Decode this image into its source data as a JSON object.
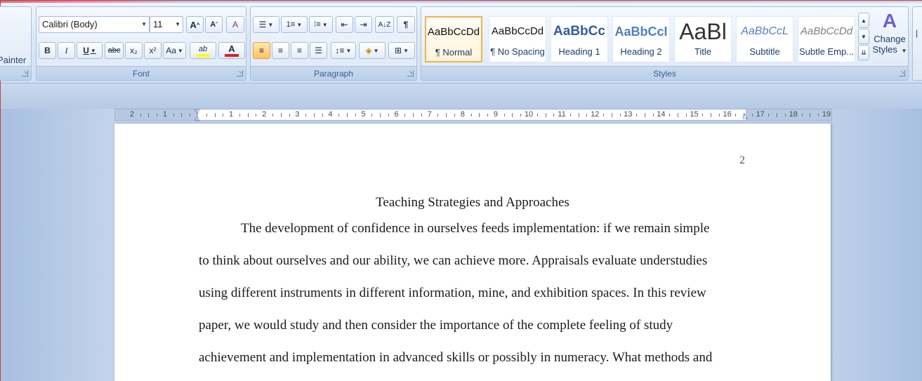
{
  "clipboard": {
    "label": "Painter"
  },
  "font": {
    "name": "Calibri (Body)",
    "size": "11",
    "grow_label": "A",
    "shrink_label": "A",
    "clear_label": "A",
    "bold": "B",
    "italic": "I",
    "underline": "U",
    "strike": "abc",
    "subscript": "x₂",
    "superscript": "x²",
    "change_case": "Aa",
    "highlight_label": "ab",
    "font_color_label": "A",
    "group_label": "Font",
    "highlight_color": "#ffff00",
    "font_color": "#e02020"
  },
  "paragraph": {
    "group_label": "Paragraph",
    "show_marks": "¶"
  },
  "styles": {
    "group_label": "Styles",
    "tiles": [
      {
        "sample": "AaBbCcDd",
        "name": "¶ Normal",
        "selected": true
      },
      {
        "sample": "AaBbCcDd",
        "name": "¶ No Spacing",
        "selected": false
      },
      {
        "sample": "AaBbCc",
        "name": "Heading 1",
        "selected": false
      },
      {
        "sample": "AaBbCcI",
        "name": "Heading 2",
        "selected": false
      },
      {
        "sample": "AaBl",
        "name": "Title",
        "selected": false
      },
      {
        "sample": "AaBbCcL",
        "name": "Subtitle",
        "selected": false
      },
      {
        "sample": "AaBbCcDd",
        "name": "Subtle Emp...",
        "selected": false
      }
    ],
    "change_styles_line1": "Change",
    "change_styles_line2": "Styles"
  },
  "ruler": {
    "numbers": [
      "2",
      "1",
      "1",
      "2",
      "3",
      "4",
      "5",
      "6",
      "7",
      "8",
      "9",
      "10",
      "11",
      "12",
      "13",
      "14",
      "15",
      "16",
      "17",
      "18",
      "19"
    ]
  },
  "document": {
    "page_number": "2",
    "title": "Teaching Strategies and Approaches",
    "lines": [
      "The development of confidence in ourselves feeds implementation: if we remain simple",
      "to think about ourselves and our ability, we can achieve more. Appraisals evaluate understudies",
      "using different instruments in different information, mine, and exhibition spaces. In this review",
      "paper, we would study and then consider the importance of the complete feeling of study",
      "achievement and implementation in advanced skills or possibly in numeracy. What methods and"
    ]
  }
}
